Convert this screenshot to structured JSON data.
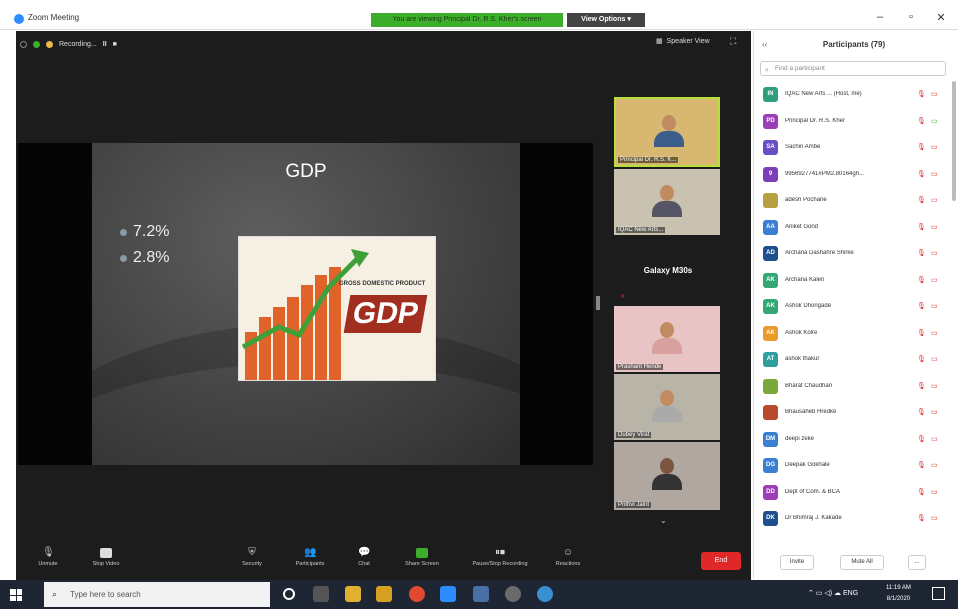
{
  "window": {
    "title": "Zoom Meeting",
    "banner": "You are viewing Principal Dr. R.S. Kher's screen",
    "view_options": "View Options ▾"
  },
  "meeting_bar": {
    "recording": "Recording...",
    "speaker_view": "Speaker View"
  },
  "slide": {
    "title": "GDP",
    "bullets": [
      "7.2%",
      "2.8%"
    ],
    "image_text": "GDP",
    "image_caption": "GROSS DOMESTIC PRODUCT"
  },
  "thumbnails": [
    {
      "label": "Principal Dr. R.S. K..."
    },
    {
      "label": "IQAC New Arts..."
    },
    {
      "label": "Galaxy M30s"
    },
    {
      "label": "Prashant Hende"
    },
    {
      "label": "Dubey Virat"
    },
    {
      "label": "Prithvi Jaint"
    }
  ],
  "toolbar": {
    "unmute": "Unmute",
    "video": "Stop Video",
    "security": "Security",
    "participants": "Participants",
    "chat": "Chat",
    "share": "Share Screen",
    "pause_rec": "Pause/Stop Recording",
    "reactions": "Reactions",
    "end": "End"
  },
  "panel": {
    "title": "Participants (79)",
    "search_placeholder": "Find a participant",
    "participants": [
      {
        "initials": "IN",
        "name": "IQAC New Arts ... (Host, me)",
        "color": "#2e9e7e"
      },
      {
        "initials": "PD",
        "name": "Principal Dr. R.S. Kher",
        "color": "#9a3fb8"
      },
      {
        "initials": "SA",
        "name": "Sachin Ambe",
        "color": "#6a4fc4"
      },
      {
        "initials": "9",
        "name": "9956927741#PM2.80164gh...",
        "color": "#7b3fb8"
      },
      {
        "initials": "",
        "name": "adesh Pochane",
        "color": "#b8a040"
      },
      {
        "initials": "AA",
        "name": "Aniket Gond",
        "color": "#3a7fd1"
      },
      {
        "initials": "AD",
        "name": "Archana Dashahre Shirke",
        "color": "#1e4e8c"
      },
      {
        "initials": "AK",
        "name": "Archana Kaleri",
        "color": "#34a874"
      },
      {
        "initials": "AK",
        "name": "Ashok Dhongade",
        "color": "#34a874"
      },
      {
        "initials": "AK",
        "name": "Ashok Kolre",
        "color": "#e89a2a"
      },
      {
        "initials": "AT",
        "name": "ashok thakur",
        "color": "#2e9e9e"
      },
      {
        "initials": "",
        "name": "Bharat Chaudhari",
        "color": "#7aa83a"
      },
      {
        "initials": "",
        "name": "Bhausaheb Hredke",
        "color": "#b84a2e"
      },
      {
        "initials": "DM",
        "name": "deepi zeke",
        "color": "#3a7fd1"
      },
      {
        "initials": "DG",
        "name": "Deepak Gokhale",
        "color": "#3a7fd1"
      },
      {
        "initials": "DD",
        "name": "Dept of Com. & BCA",
        "color": "#9a3fb8"
      },
      {
        "initials": "DK",
        "name": "Dr Bhimraj J. Kakade",
        "color": "#1e4e8c"
      }
    ],
    "invite": "Invite",
    "mute_all": "Mute All",
    "more": "..."
  },
  "taskbar": {
    "search_placeholder": "Type here to search",
    "lang": "ENG",
    "time": "11:19 AM",
    "date": "8/1/2020"
  }
}
